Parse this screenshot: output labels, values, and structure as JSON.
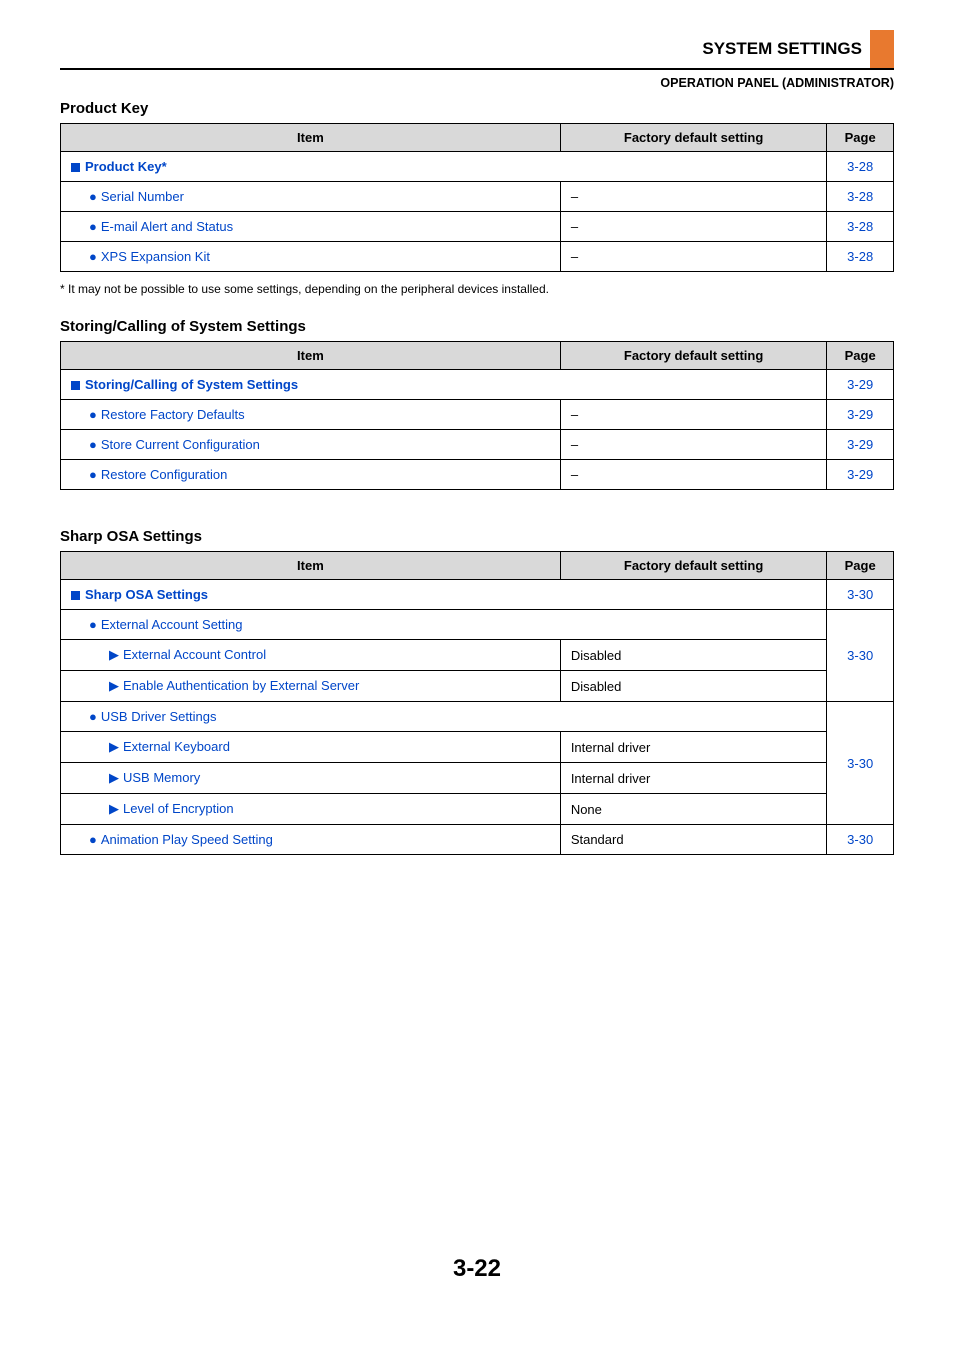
{
  "header": {
    "title": "SYSTEM SETTINGS",
    "subtitle": "OPERATION PANEL (ADMINISTRATOR)"
  },
  "columns": {
    "item": "Item",
    "setting": "Factory default setting",
    "page": "Page"
  },
  "productKey": {
    "title": "Product Key",
    "headingLabel": "Product Key*",
    "headingPage": "3-28",
    "rows": [
      {
        "label": "Serial Number",
        "setting": "–",
        "page": "3-28"
      },
      {
        "label": "E-mail Alert and Status",
        "setting": "–",
        "page": "3-28"
      },
      {
        "label": "XPS Expansion Kit",
        "setting": "–",
        "page": "3-28"
      }
    ],
    "footnote": "*  It may not be possible to use some settings, depending on the peripheral devices installed."
  },
  "storing": {
    "title": "Storing/Calling of System Settings",
    "headingLabel": "Storing/Calling of System Settings",
    "headingPage": "3-29",
    "rows": [
      {
        "label": "Restore Factory Defaults",
        "setting": "–",
        "page": "3-29"
      },
      {
        "label": "Store Current Configuration",
        "setting": "–",
        "page": "3-29"
      },
      {
        "label": "Restore Configuration",
        "setting": "–",
        "page": "3-29"
      }
    ]
  },
  "osa": {
    "title": "Sharp OSA Settings",
    "headingLabel": "Sharp OSA Settings",
    "headingPage": "3-30",
    "extAcctHeader": "External Account Setting",
    "extAcctRows": [
      {
        "label": "External Account Control",
        "setting": "Disabled"
      },
      {
        "label": "Enable Authentication by External Server",
        "setting": "Disabled"
      }
    ],
    "extAcctPage": "3-30",
    "usbHeader": "USB Driver Settings",
    "usbRows": [
      {
        "label": "External Keyboard",
        "setting": "Internal driver"
      },
      {
        "label": "USB Memory",
        "setting": "Internal driver"
      },
      {
        "label": "Level of Encryption",
        "setting": "None"
      }
    ],
    "usbPage": "3-30",
    "anim": {
      "label": "Animation Play Speed Setting",
      "setting": "Standard",
      "page": "3-30"
    }
  },
  "pageNumber": "3-22"
}
